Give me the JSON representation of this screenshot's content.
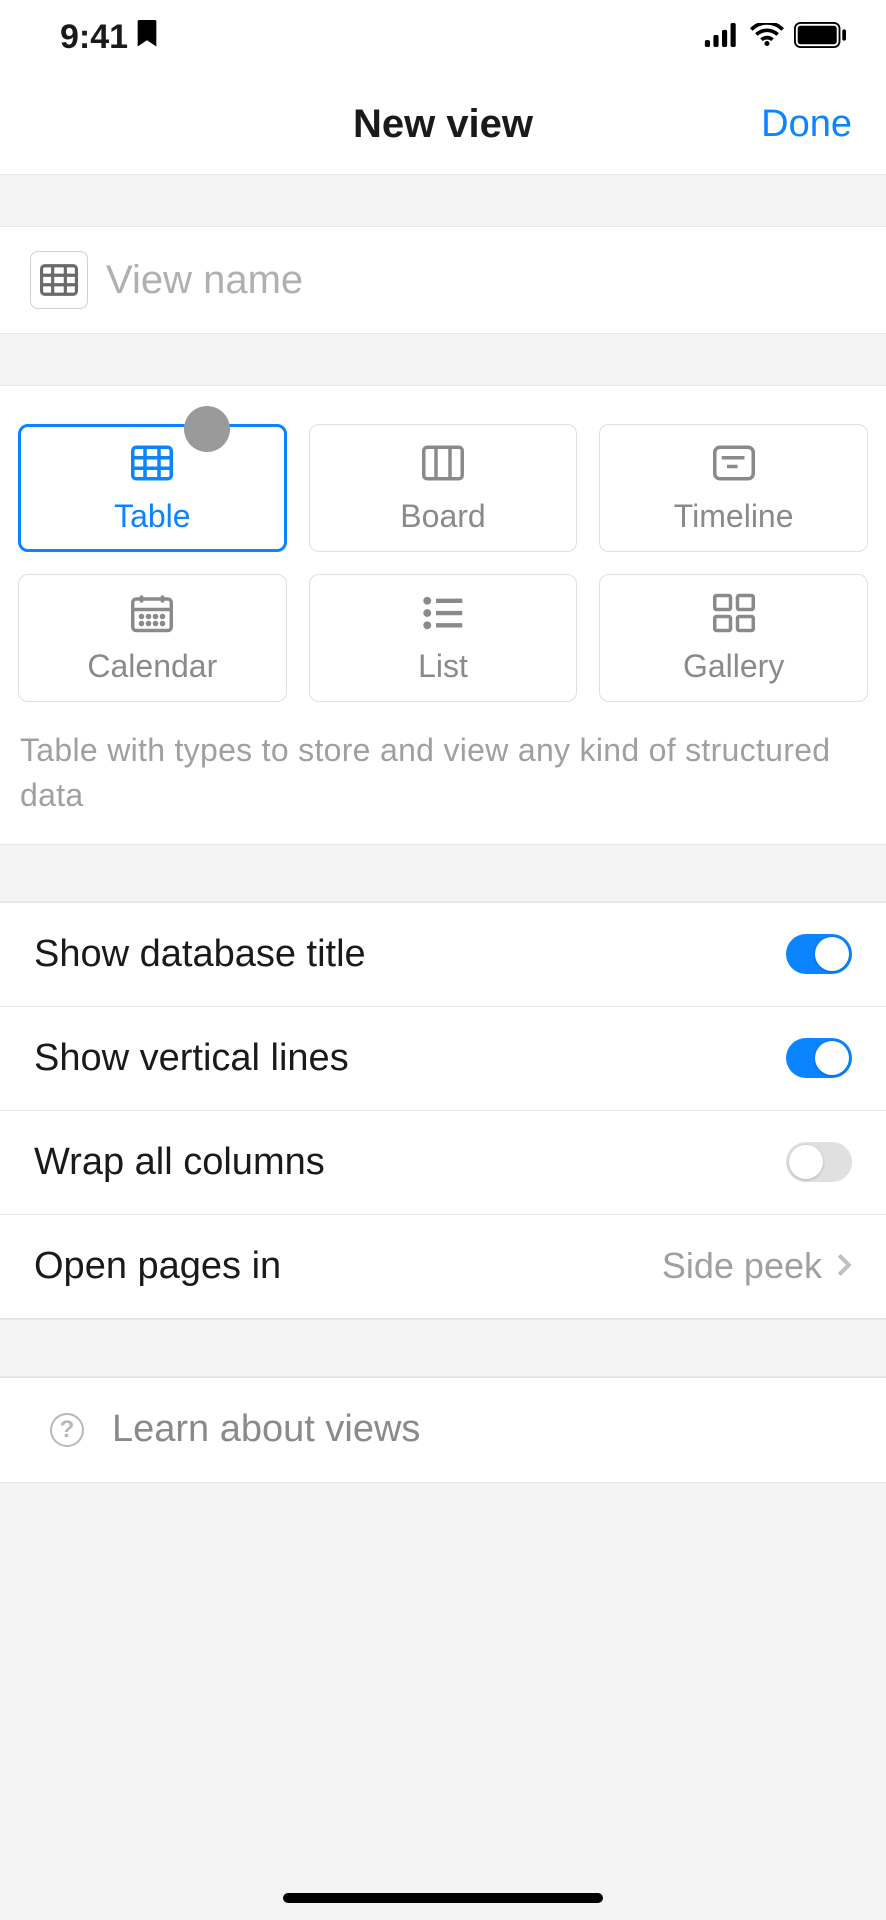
{
  "status": {
    "time": "9:41"
  },
  "header": {
    "title": "New view",
    "done": "Done"
  },
  "input": {
    "placeholder": "View name",
    "value": ""
  },
  "view_types": [
    {
      "key": "table",
      "label": "Table",
      "selected": true
    },
    {
      "key": "board",
      "label": "Board",
      "selected": false
    },
    {
      "key": "timeline",
      "label": "Timeline",
      "selected": false
    },
    {
      "key": "calendar",
      "label": "Calendar",
      "selected": false
    },
    {
      "key": "list",
      "label": "List",
      "selected": false
    },
    {
      "key": "gallery",
      "label": "Gallery",
      "selected": false
    }
  ],
  "view_description": "Table with types to store and view any kind of structured data",
  "settings": {
    "show_db_title": {
      "label": "Show database title",
      "on": true
    },
    "show_vlines": {
      "label": "Show vertical lines",
      "on": true
    },
    "wrap_cols": {
      "label": "Wrap all columns",
      "on": false
    },
    "open_pages": {
      "label": "Open pages in",
      "value": "Side peek"
    }
  },
  "learn": {
    "label": "Learn about views"
  }
}
